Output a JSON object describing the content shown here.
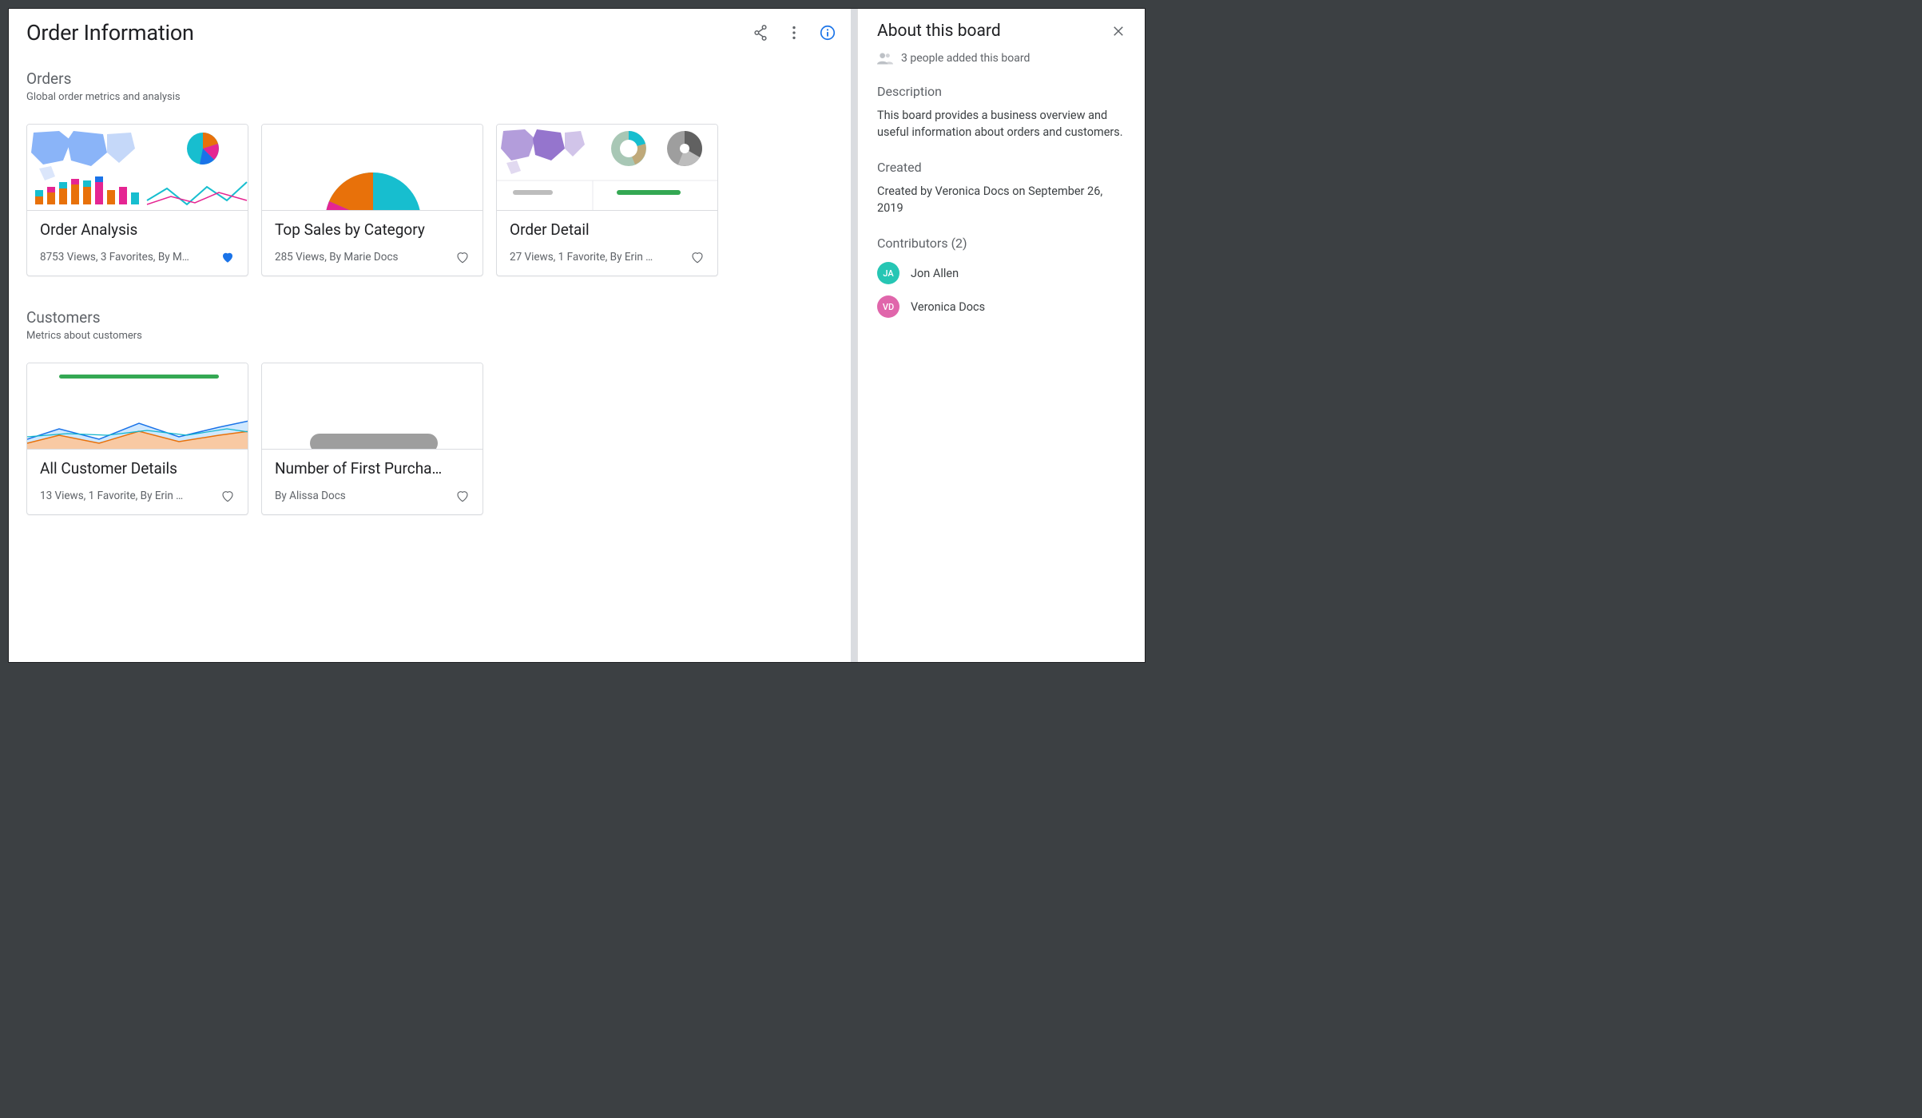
{
  "page": {
    "title": "Order Information"
  },
  "sections": [
    {
      "title": "Orders",
      "subtitle": "Global order metrics and analysis",
      "cards": [
        {
          "title": "Order Analysis",
          "meta": "8753 Views, 3 Favorites, By M…",
          "favorited": true
        },
        {
          "title": "Top Sales by Category",
          "meta": "285 Views, By Marie Docs",
          "favorited": false
        },
        {
          "title": "Order Detail",
          "meta": "27 Views, 1 Favorite, By Erin …",
          "favorited": false
        }
      ]
    },
    {
      "title": "Customers",
      "subtitle": "Metrics about customers",
      "cards": [
        {
          "title": "All Customer Details",
          "meta": "13 Views, 1 Favorite, By Erin …",
          "favorited": false
        },
        {
          "title": "Number of First Purcha…",
          "meta": "By Alissa Docs",
          "favorited": false
        }
      ]
    }
  ],
  "about": {
    "title": "About this board",
    "people_added": "3 people added this board",
    "description_label": "Description",
    "description_text": "This board provides a business overview and useful information about orders and customers.",
    "created_label": "Created",
    "created_text": "Created by Veronica Docs on September 26, 2019",
    "contributors_label": "Contributors (2)",
    "contributors": [
      {
        "initials": "JA",
        "name": "Jon Allen",
        "color": "teal"
      },
      {
        "initials": "VD",
        "name": "Veronica Docs",
        "color": "pink"
      }
    ]
  }
}
